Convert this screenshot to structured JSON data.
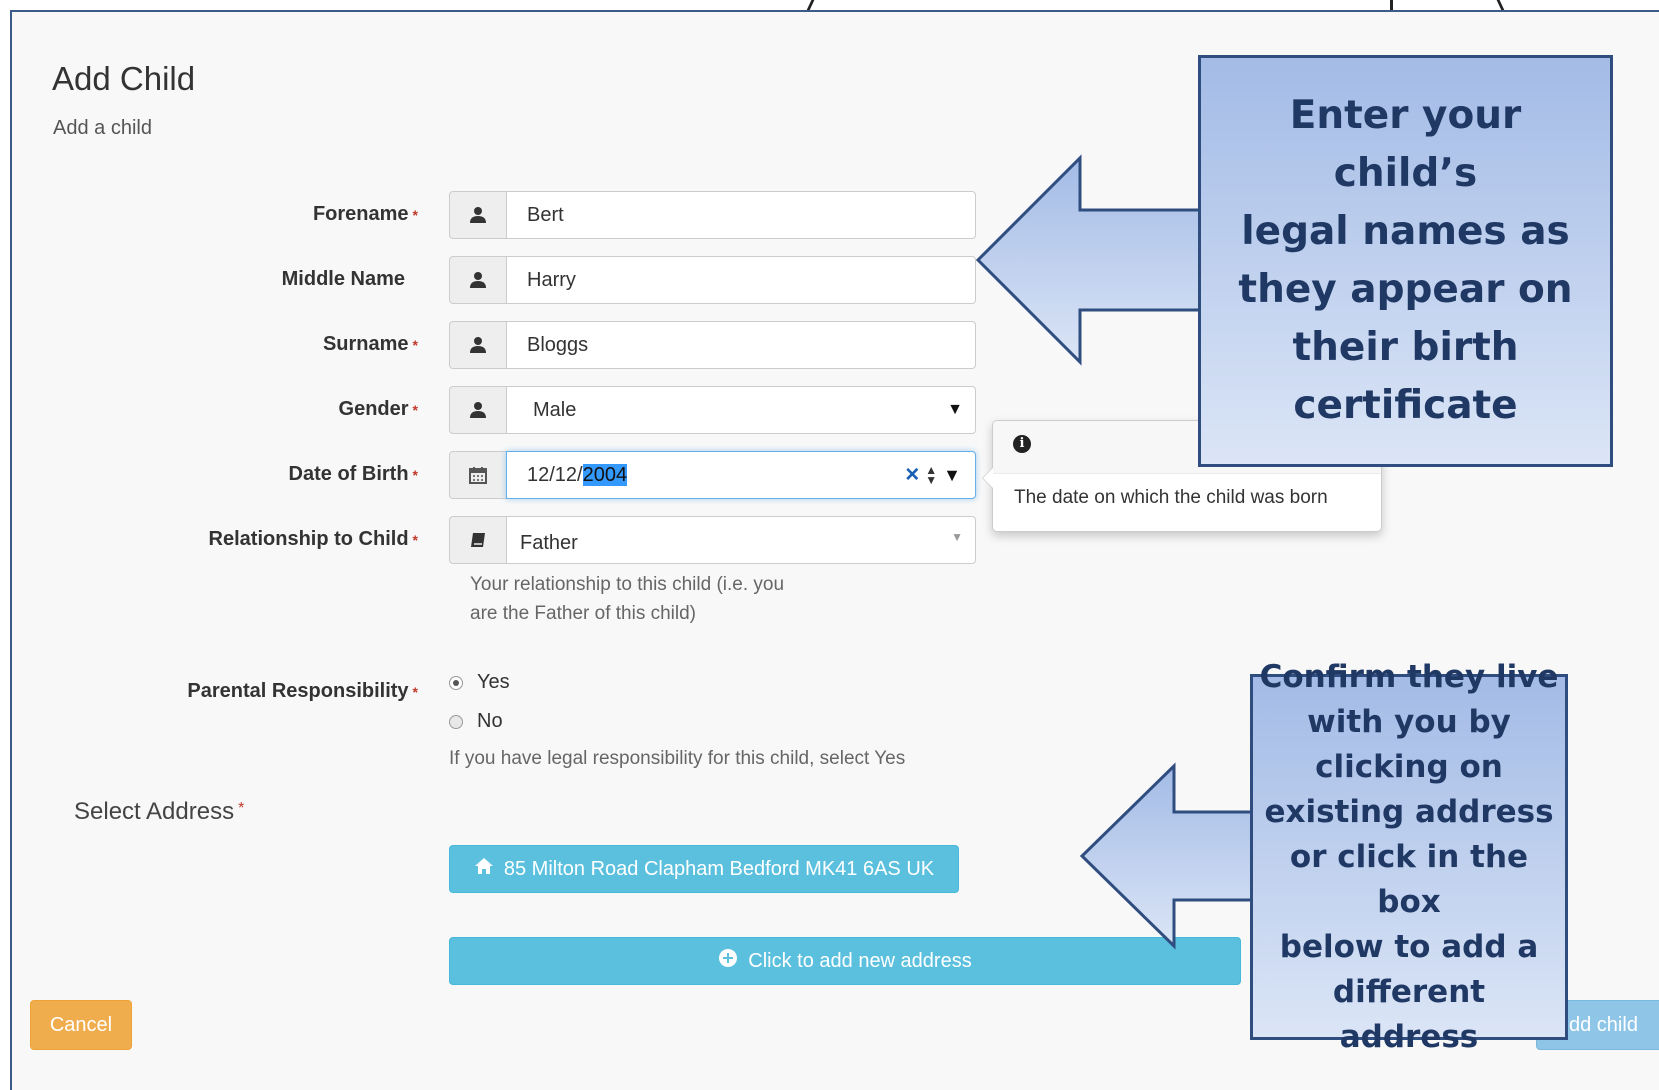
{
  "page": {
    "title": "Add Child",
    "subtitle": "Add a child"
  },
  "form": {
    "forename": {
      "label": "Forename",
      "value": "Bert",
      "required": true,
      "icon": "user-icon"
    },
    "middle_name": {
      "label": "Middle Name",
      "value": "Harry",
      "required": false,
      "icon": "user-icon"
    },
    "surname": {
      "label": "Surname",
      "value": "Bloggs",
      "required": true,
      "icon": "user-icon"
    },
    "gender": {
      "label": "Gender",
      "value": "Male",
      "required": true,
      "icon": "user-icon"
    },
    "date_of_birth": {
      "label": "Date of Birth",
      "value_prefix": "12/12/",
      "value_selected": "2004",
      "required": true,
      "icon": "calendar-icon",
      "clear_glyph": "×"
    },
    "relationship": {
      "label": "Relationship to Child",
      "value": "Father",
      "required": true,
      "icon": "book-icon",
      "help_line1": "Your relationship to this child (i.e. you",
      "help_line2": "are the Father of this child)"
    },
    "parental_responsibility": {
      "label": "Parental Responsibility",
      "required": true,
      "options": [
        "Yes",
        "No"
      ],
      "selected": "Yes",
      "help": "If you have legal responsibility for this child, select Yes"
    },
    "address": {
      "label": "Select Address",
      "existing": "85 Milton Road Clapham Bedford MK41 6AS UK",
      "add_new": "Click to add new address"
    },
    "required_marker": "*"
  },
  "tooltip": {
    "text": "The date on which the child was born",
    "icon": "info-icon"
  },
  "buttons": {
    "cancel": "Cancel",
    "add_child": "dd child"
  },
  "callouts": {
    "names": [
      "Enter your child’s",
      "legal names as",
      "they appear on",
      "their birth",
      "certificate"
    ],
    "address": [
      "Confirm they live",
      "with you by",
      "clicking on",
      "existing address",
      "or click in the box",
      "below to add a",
      "different address"
    ]
  },
  "colors": {
    "info_button": "#5bc0de",
    "warning_button": "#f0ad4e",
    "callout_border": "#2f4d7f",
    "callout_text": "#1f3864",
    "required": "#c0392b"
  }
}
